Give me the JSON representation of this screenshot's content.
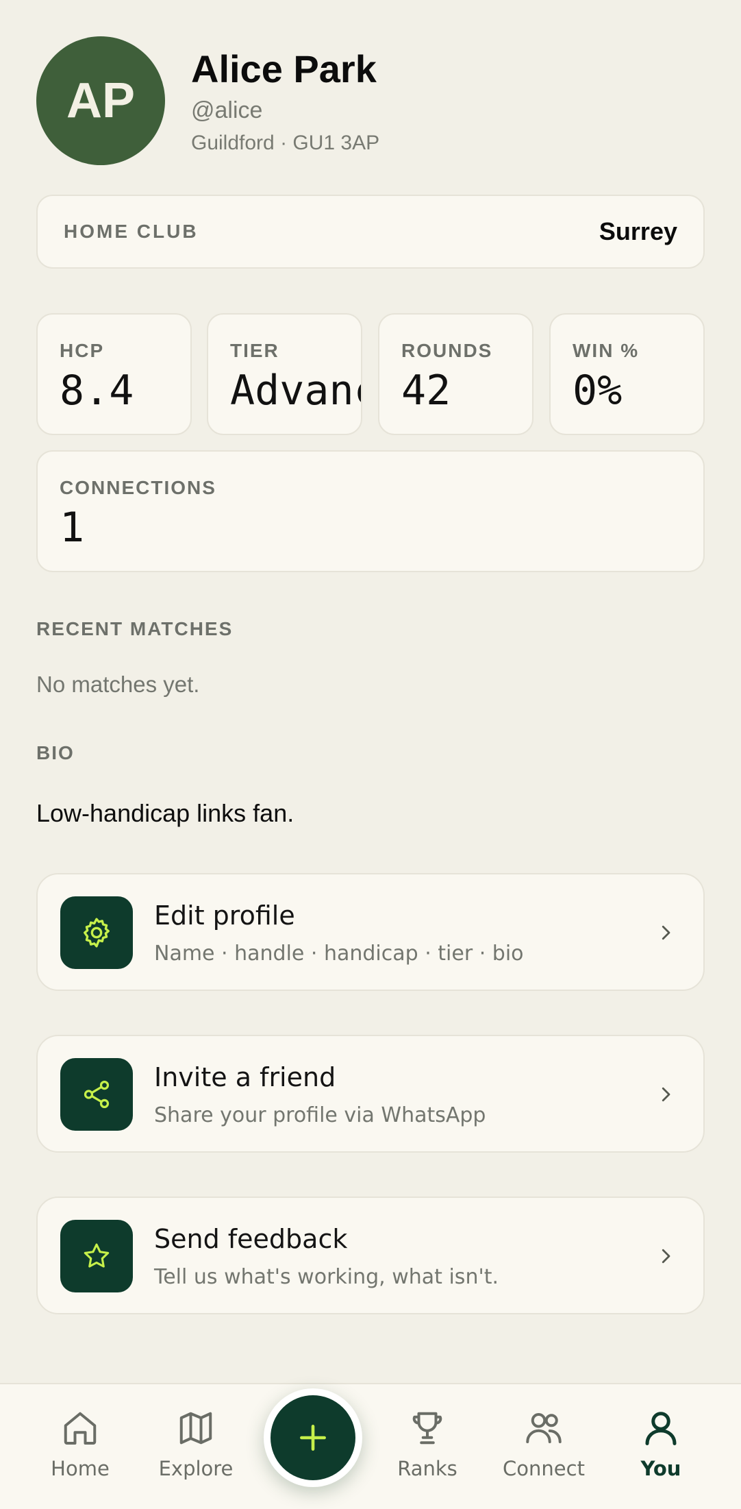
{
  "profile": {
    "initials": "AP",
    "name": "Alice Park",
    "handle": "@alice",
    "location": "Guildford · GU1 3AP",
    "avatar_color": "#3f5f3a"
  },
  "home_club": {
    "label": "HOME CLUB",
    "value": "Surrey"
  },
  "stats": [
    {
      "label": "HCP",
      "value": "8.4"
    },
    {
      "label": "TIER",
      "value": "Advanced"
    },
    {
      "label": "ROUNDS",
      "value": "42"
    },
    {
      "label": "WIN %",
      "value": "0%"
    }
  ],
  "connections": {
    "label": "CONNECTIONS",
    "value": "1"
  },
  "recent_matches": {
    "label": "RECENT MATCHES",
    "empty_text": "No matches yet."
  },
  "bio": {
    "label": "BIO",
    "text": "Low-handicap links fan."
  },
  "actions": [
    {
      "title": "Edit profile",
      "subtitle": "Name · handle · handicap · tier · bio",
      "icon": "gear-icon"
    },
    {
      "title": "Invite a friend",
      "subtitle": "Share your profile via WhatsApp",
      "icon": "share-icon"
    },
    {
      "title": "Send feedback",
      "subtitle": "Tell us what's working, what isn't.",
      "icon": "star-icon"
    }
  ],
  "nav": {
    "items": [
      {
        "label": "Home",
        "icon": "home-icon"
      },
      {
        "label": "Explore",
        "icon": "map-icon"
      },
      {
        "label": "Ranks",
        "icon": "trophy-icon"
      },
      {
        "label": "Connect",
        "icon": "users-icon"
      },
      {
        "label": "You",
        "icon": "user-icon",
        "active": true
      }
    ],
    "fab_icon": "plus-icon"
  },
  "colors": {
    "background": "#f2f0e7",
    "card": "#faf8f1",
    "accent_dark": "#0e3b2c",
    "accent_lime": "#c6f04a",
    "muted_text": "#73766f"
  }
}
